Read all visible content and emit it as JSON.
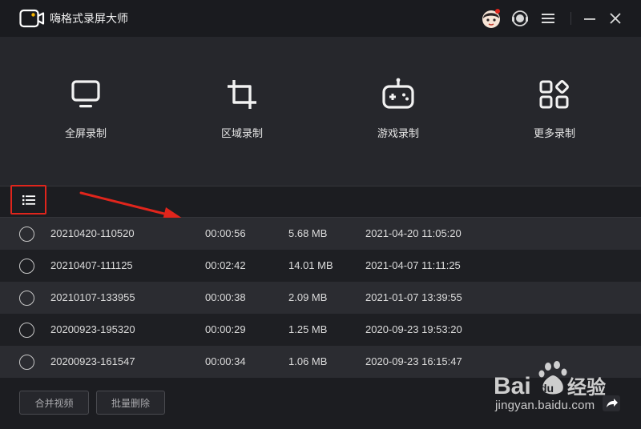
{
  "app": {
    "title": "嗨格式录屏大师"
  },
  "modes": [
    {
      "label": "全屏录制",
      "icon": "monitor-icon"
    },
    {
      "label": "区域录制",
      "icon": "crop-icon"
    },
    {
      "label": "游戏录制",
      "icon": "gamepad-icon"
    },
    {
      "label": "更多录制",
      "icon": "grid-icon"
    }
  ],
  "files": [
    {
      "name": "20210420-110520",
      "duration": "00:00:56",
      "size": "5.68 MB",
      "date": "2021-04-20 11:05:20"
    },
    {
      "name": "20210407-111125",
      "duration": "00:02:42",
      "size": "14.01 MB",
      "date": "2021-04-07 11:11:25"
    },
    {
      "name": "20210107-133955",
      "duration": "00:00:38",
      "size": "2.09 MB",
      "date": "2021-01-07 13:39:55"
    },
    {
      "name": "20200923-195320",
      "duration": "00:00:29",
      "size": "1.25 MB",
      "date": "2020-09-23 19:53:20"
    },
    {
      "name": "20200923-161547",
      "duration": "00:00:34",
      "size": "1.06 MB",
      "date": "2020-09-23 16:15:47"
    }
  ],
  "actions": {
    "merge": "合并视频",
    "batch_delete": "批量删除"
  },
  "watermark": {
    "brand": "Baidu 经验",
    "url": "jingyan.baidu.com"
  },
  "colors": {
    "accent": "#e0251c",
    "background": "#1c1d21",
    "panel": "#26272c"
  }
}
